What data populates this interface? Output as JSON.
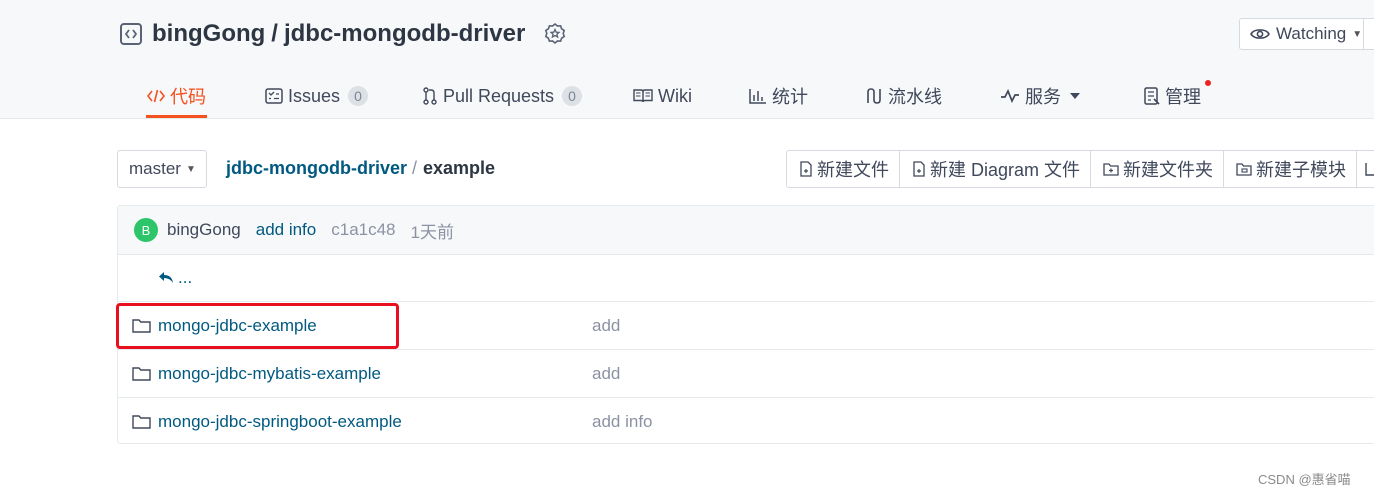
{
  "repo": {
    "owner": "bingGong",
    "separator": "/",
    "name": "jdbc-mongodb-driver"
  },
  "watch": {
    "label": "Watching"
  },
  "nav": {
    "tabs": [
      {
        "label": "代码",
        "active": true
      },
      {
        "label": "Issues",
        "count": "0"
      },
      {
        "label": "Pull Requests",
        "count": "0"
      },
      {
        "label": "Wiki"
      },
      {
        "label": "统计"
      },
      {
        "label": "流水线"
      },
      {
        "label": "服务"
      },
      {
        "label": "管理"
      }
    ]
  },
  "branch": {
    "label": "master"
  },
  "breadcrumb": {
    "root": "jdbc-mongodb-driver",
    "separator": "/",
    "current": "example"
  },
  "actions": {
    "new_file": "新建文件",
    "new_diagram": "新建 Diagram 文件",
    "new_folder": "新建文件夹",
    "new_submodule": "新建子模块"
  },
  "commit": {
    "avatar_letter": "B",
    "author": "bingGong",
    "message": "add info",
    "hash": "c1a1c48",
    "time": "1天前"
  },
  "back_label": "...",
  "files": [
    {
      "name": "mongo-jdbc-example",
      "message": "add"
    },
    {
      "name": "mongo-jdbc-mybatis-example",
      "message": "add"
    },
    {
      "name": "mongo-jdbc-springboot-example",
      "message": "add info"
    }
  ],
  "watermark": "CSDN @惠省喵",
  "colors": {
    "accent": "#f4511e",
    "link": "#005980",
    "avatar": "#2dc569",
    "highlight": "#e8101e"
  }
}
